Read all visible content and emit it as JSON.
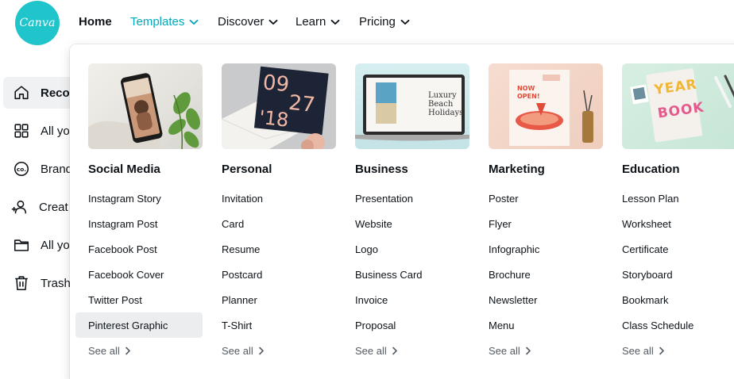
{
  "brand": {
    "logo_text": "Canva",
    "color": "#20c4cb"
  },
  "nav": [
    {
      "label": "Home",
      "has_chevron": false
    },
    {
      "label": "Templates",
      "has_chevron": true,
      "active": true
    },
    {
      "label": "Discover",
      "has_chevron": true
    },
    {
      "label": "Learn",
      "has_chevron": true
    },
    {
      "label": "Pricing",
      "has_chevron": true
    }
  ],
  "sidebar": [
    {
      "label": "Recent",
      "visible_text": "Recor",
      "icon": "home-icon",
      "selected": true
    },
    {
      "label": "All your designs",
      "visible_text": "All yo",
      "icon": "grid-icon"
    },
    {
      "label": "Brand Kit",
      "visible_text": "Brand",
      "icon": "brand-kit-icon"
    },
    {
      "label": "Create a team",
      "visible_text": "Creat",
      "icon": "add-user-icon"
    },
    {
      "label": "All your folders",
      "visible_text": "All yo",
      "icon": "folder-icon"
    },
    {
      "label": "Trash",
      "visible_text": "Trash",
      "icon": "trash-icon"
    }
  ],
  "dropdown": {
    "columns": [
      {
        "title": "Social Media",
        "thumbnail": "phone-mockup",
        "links": [
          "Instagram Story",
          "Instagram Post",
          "Facebook Post",
          "Facebook Cover",
          "Twitter Post",
          "Pinterest Graphic"
        ],
        "hovered_link": "Pinterest Graphic",
        "see_all": "See all"
      },
      {
        "title": "Personal",
        "thumbnail": "date-card",
        "thumb_text": {
          "line1": "09",
          "line2": "27",
          "line3": "'18"
        },
        "links": [
          "Invitation",
          "Card",
          "Resume",
          "Postcard",
          "Planner",
          "T-Shirt"
        ],
        "see_all": "See all"
      },
      {
        "title": "Business",
        "thumbnail": "laptop-presentation",
        "thumb_text": {
          "line1": "Luxury",
          "line2": "Beach",
          "line3": "Holidays"
        },
        "links": [
          "Presentation",
          "Website",
          "Logo",
          "Business Card",
          "Invoice",
          "Proposal"
        ],
        "see_all": "See all"
      },
      {
        "title": "Marketing",
        "thumbnail": "pizza-poster",
        "thumb_text": {
          "line1": "NOW",
          "line2": "OPEN!"
        },
        "links": [
          "Poster",
          "Flyer",
          "Infographic",
          "Brochure",
          "Newsletter",
          "Menu"
        ],
        "see_all": "See all"
      },
      {
        "title": "Education",
        "thumbnail": "yearbook",
        "thumb_text": {
          "line1": "YEAR",
          "line2": "BOOK"
        },
        "links": [
          "Lesson Plan",
          "Worksheet",
          "Certificate",
          "Storyboard",
          "Bookmark",
          "Class Schedule"
        ],
        "see_all": "See all"
      }
    ]
  }
}
